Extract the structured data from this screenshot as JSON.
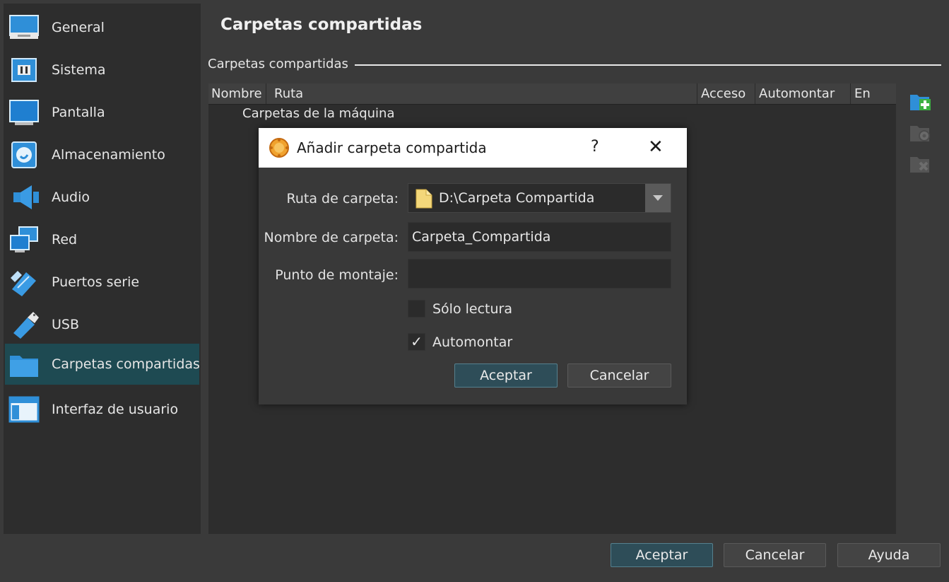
{
  "sidebar": {
    "items": [
      {
        "label": "General",
        "icon": "general-icon"
      },
      {
        "label": "Sistema",
        "icon": "chip-icon"
      },
      {
        "label": "Pantalla",
        "icon": "monitor-icon"
      },
      {
        "label": "Almacenamiento",
        "icon": "disk-icon"
      },
      {
        "label": "Audio",
        "icon": "speaker-icon"
      },
      {
        "label": "Red",
        "icon": "network-icon"
      },
      {
        "label": "Puertos serie",
        "icon": "serial-port-icon"
      },
      {
        "label": "USB",
        "icon": "usb-icon"
      },
      {
        "label": "Carpetas compartidas",
        "icon": "folder-icon",
        "selected": true
      },
      {
        "label": "Interfaz de usuario",
        "icon": "window-icon"
      }
    ]
  },
  "main": {
    "title": "Carpetas compartidas",
    "group_label": "Carpetas compartidas",
    "table": {
      "columns": [
        "Nombre",
        "Ruta",
        "Acceso",
        "Automontar",
        "En"
      ],
      "tree_root": "Carpetas de la máquina"
    },
    "tools": [
      "add-folder-icon",
      "edit-folder-icon",
      "remove-folder-icon"
    ]
  },
  "footer": {
    "ok": "Aceptar",
    "cancel": "Cancelar",
    "help": "Ayuda"
  },
  "dialog": {
    "title": "Añadir carpeta compartida",
    "help": "?",
    "close": "✕",
    "path_label": "Ruta de carpeta:",
    "path_value": "D:\\Carpeta Compartida",
    "name_label": "Nombre de carpeta:",
    "name_value": "Carpeta_Compartida",
    "mount_label": "Punto de montaje:",
    "mount_value": "",
    "readonly_label": "Sólo lectura",
    "readonly_checked": false,
    "automount_label": "Automontar",
    "automount_checked": true,
    "checkmark": "✓",
    "ok": "Aceptar",
    "cancel": "Cancelar"
  },
  "colors": {
    "selected_bg": "#1e4a52",
    "accent_blue": "#2f8fd8",
    "default_button": "#2e4d58"
  }
}
